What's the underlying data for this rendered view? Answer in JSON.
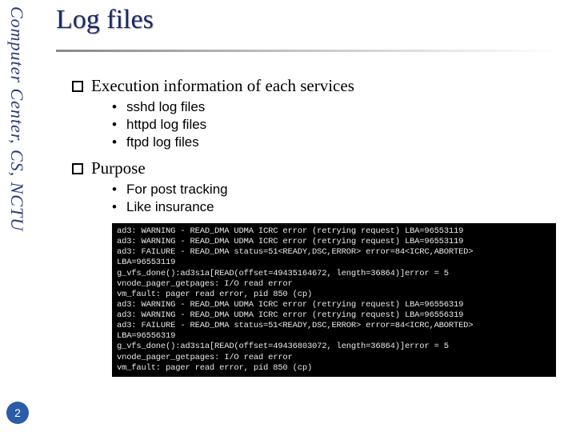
{
  "sidebar": "Computer Center, CS, NCTU",
  "page_number": "2",
  "title": "Log files",
  "sections": [
    {
      "heading": "Execution information of each services",
      "items": [
        "sshd log files",
        "httpd log files",
        "ftpd log files"
      ]
    },
    {
      "heading": "Purpose",
      "items": [
        "For post tracking",
        "Like insurance"
      ]
    }
  ],
  "terminal_lines": [
    "ad3: WARNING - READ_DMA UDMA ICRC error (retrying request) LBA=96553119",
    "ad3: WARNING - READ_DMA UDMA ICRC error (retrying request) LBA=96553119",
    "ad3: FAILURE - READ_DMA status=51<READY,DSC,ERROR> error=84<ICRC,ABORTED>",
    "LBA=96553119",
    "g_vfs_done():ad3s1a[READ(offset=49435164672, length=36864)]error = 5",
    "vnode_pager_getpages: I/O read error",
    "vm_fault: pager read error, pid 850 (cp)",
    "ad3: WARNING - READ_DMA UDMA ICRC error (retrying request) LBA=96556319",
    "ad3: WARNING - READ_DMA UDMA ICRC error (retrying request) LBA=96556319",
    "ad3: FAILURE - READ_DMA status=51<READY,DSC,ERROR> error=84<ICRC,ABORTED>",
    "LBA=96556319",
    "g_vfs_done():ad3s1a[READ(offset=49436803072, length=36864)]error = 5",
    "vnode_pager_getpages: I/O read error",
    "vm_fault: pager read error, pid 850 (cp)"
  ]
}
